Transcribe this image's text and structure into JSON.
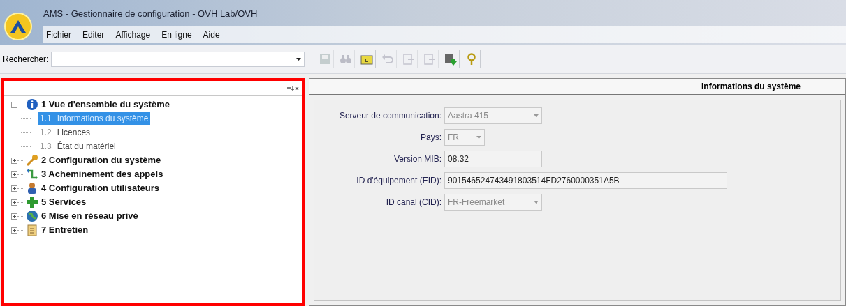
{
  "window": {
    "title": "AMS  - Gestionnaire de configuration - OVH Lab/OVH"
  },
  "menu": [
    "Fichier",
    "Editer",
    "Affichage",
    "En ligne",
    "Aide"
  ],
  "search": {
    "label": "Rechercher:"
  },
  "toolbar": [
    {
      "kind": "save",
      "disabled": true
    },
    {
      "kind": "find",
      "disabled": true
    },
    {
      "kind": "folder",
      "disabled": false
    },
    {
      "kind": "undo",
      "disabled": true
    },
    {
      "kind": "export",
      "disabled": true
    },
    {
      "kind": "import",
      "disabled": true
    },
    {
      "kind": "download",
      "disabled": false
    },
    {
      "kind": "help",
      "disabled": false
    }
  ],
  "tree": [
    {
      "label": "1 Vue d'ensemble du système",
      "expanded": true,
      "children": [
        {
          "number": "1.1",
          "label": "Informations du système",
          "selected": true
        },
        {
          "number": "1.2",
          "label": "Licences",
          "selected": false
        },
        {
          "number": "1.3",
          "label": "État du matériel",
          "selected": false
        }
      ]
    },
    {
      "label": "2 Configuration du système",
      "expanded": false
    },
    {
      "label": "3 Acheminement des appels",
      "expanded": false
    },
    {
      "label": "4 Configuration utilisateurs",
      "expanded": false
    },
    {
      "label": "5 Services",
      "expanded": false
    },
    {
      "label": "6 Mise en réseau privé",
      "expanded": false
    },
    {
      "label": "7 Entretien",
      "expanded": false
    }
  ],
  "panel": {
    "title": "Informations du système"
  },
  "fields": [
    {
      "label": "Serveur de communication:",
      "value": "Aastra 415",
      "kind": "combo"
    },
    {
      "label": "Pays:",
      "value": "FR",
      "kind": "combo"
    },
    {
      "label": "Version MIB:",
      "value": "08.32",
      "kind": "text"
    },
    {
      "label": "ID d'équipement (EID):",
      "value": "901546524743491803514FD2760000351A5B",
      "kind": "text"
    },
    {
      "label": "ID canal (CID):",
      "value": "FR-Freemarket",
      "kind": "combo"
    }
  ]
}
